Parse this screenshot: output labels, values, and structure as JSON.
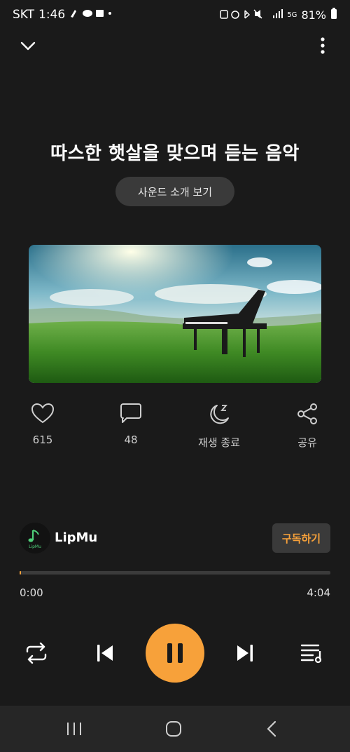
{
  "status_bar": {
    "carrier": "SKT",
    "time": "1:46",
    "network": "5G",
    "battery": "81%"
  },
  "player": {
    "title": "따스한 햇살을 맞으며 듣는 음악",
    "sound_intro_label": "사운드 소개 보기",
    "artwork_icon": "piano-field-artwork"
  },
  "actions": {
    "like_count": "615",
    "comment_count": "48",
    "sleep_timer_label": "재생 종료",
    "share_label": "공유"
  },
  "channel": {
    "name": "LipMu",
    "avatar_text": "LipMu",
    "subscribe_label": "구독하기"
  },
  "playback": {
    "current_time": "0:00",
    "total_time": "4:04",
    "progress_fraction": 0.003
  },
  "colors": {
    "accent": "#f7a13a",
    "background": "#1a1a1a",
    "button_bg": "#3a3a3a"
  }
}
